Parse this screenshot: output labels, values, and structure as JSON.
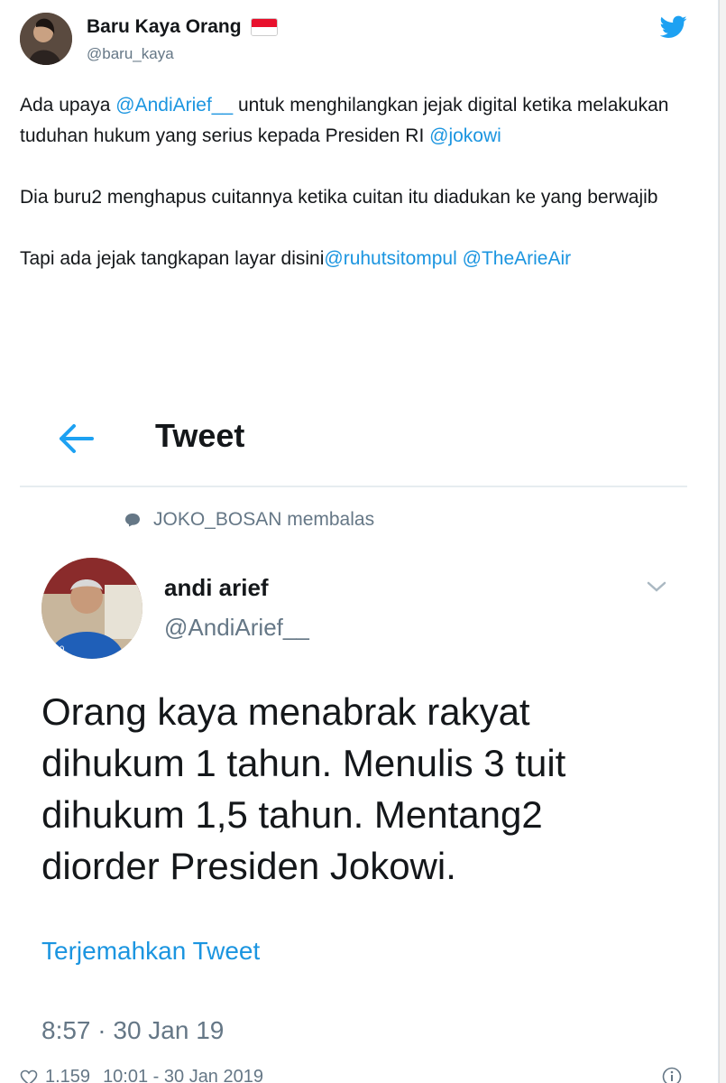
{
  "author": {
    "display_name": "Baru Kaya Orang",
    "handle": "@baru_kaya"
  },
  "tweet": {
    "paragraphs": [
      [
        {
          "text": "Ada upaya ",
          "mention": false
        },
        {
          "text": "@AndiArief__",
          "mention": true
        },
        {
          "text": " untuk menghilangkan jejak digital ketika melakukan tuduhan hukum yang serius kepada Presiden RI ",
          "mention": false
        },
        {
          "text": "@jokowi",
          "mention": true
        }
      ],
      [
        {
          "text": "Dia buru2 menghapus cuitannya ketika cuitan itu diadukan ke yang berwajib",
          "mention": false
        }
      ],
      [
        {
          "text": "Tapi ada jejak tangkapan layar disini",
          "mention": false
        },
        {
          "text": "@ruhutsitompul",
          "mention": true
        },
        {
          "text": " ",
          "mention": false
        },
        {
          "text": "@TheArieAir",
          "mention": true
        }
      ]
    ]
  },
  "embedded": {
    "header_title": "Tweet",
    "reply_context": "JOKO_BOSAN membalas",
    "author_name": "andi arief",
    "author_handle": "@AndiArief__",
    "text_lines": [
      "Orang kaya menabrak rakyat",
      "dihukum 1 tahun. Menulis 3 tuit",
      "dihukum 1,5 tahun. Mentang2",
      "diorder Presiden Jokowi."
    ],
    "translate_label": "Terjemahkan Tweet",
    "timestamp": "8:57 · 30 Jan 19"
  },
  "footer": {
    "likes": "1.159",
    "time": "10:01 - 30 Jan 2019"
  },
  "colors": {
    "mention": "#1b95e0",
    "secondary_text": "#657786",
    "primary_text": "#14171a"
  },
  "icons": [
    "twitter-bird-icon",
    "back-arrow-icon",
    "reply-bubble-icon",
    "chevron-down-icon",
    "heart-icon",
    "info-icon"
  ]
}
